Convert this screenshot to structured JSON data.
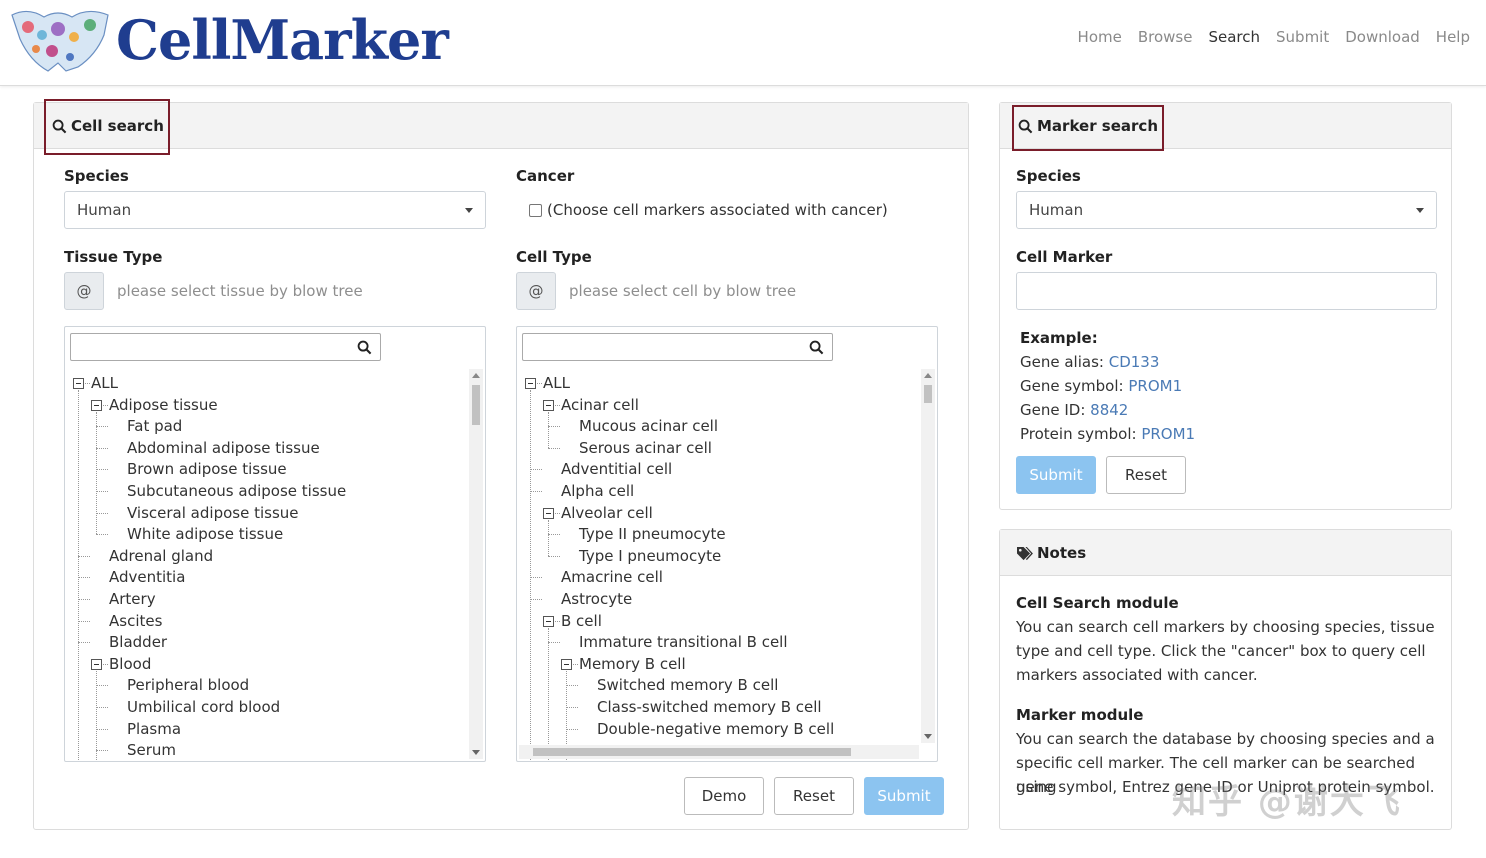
{
  "brand": {
    "name": "CellMarker"
  },
  "nav": {
    "items": [
      "Home",
      "Browse",
      "Search",
      "Submit",
      "Download",
      "Help"
    ],
    "active": "Search"
  },
  "cell_search": {
    "title": "Cell search",
    "species_label": "Species",
    "species_value": "Human",
    "cancer_label": "Cancer",
    "cancer_checkbox_label": "(Choose cell markers associated with cancer)",
    "tissue_label": "Tissue Type",
    "tissue_addon": "@",
    "tissue_placeholder": "please select tissue by blow tree",
    "cell_label": "Cell Type",
    "cell_addon": "@",
    "cell_placeholder": "please select cell by blow tree",
    "tissue_tree": [
      {
        "label": "ALL",
        "level": 0,
        "expanded": true
      },
      {
        "label": "Adipose tissue",
        "level": 1,
        "expanded": true
      },
      {
        "label": "Fat pad",
        "level": 2
      },
      {
        "label": "Abdominal adipose tissue",
        "level": 2
      },
      {
        "label": "Brown adipose tissue",
        "level": 2
      },
      {
        "label": "Subcutaneous adipose tissue",
        "level": 2
      },
      {
        "label": "Visceral adipose tissue",
        "level": 2
      },
      {
        "label": "White adipose tissue",
        "level": 2
      },
      {
        "label": "Adrenal gland",
        "level": 1
      },
      {
        "label": "Adventitia",
        "level": 1
      },
      {
        "label": "Artery",
        "level": 1
      },
      {
        "label": "Ascites",
        "level": 1
      },
      {
        "label": "Bladder",
        "level": 1
      },
      {
        "label": "Blood",
        "level": 1,
        "expanded": true
      },
      {
        "label": "Peripheral blood",
        "level": 2
      },
      {
        "label": "Umbilical cord blood",
        "level": 2
      },
      {
        "label": "Plasma",
        "level": 2
      },
      {
        "label": "Serum",
        "level": 2
      }
    ],
    "cell_tree": [
      {
        "label": "ALL",
        "level": 0,
        "expanded": true
      },
      {
        "label": "Acinar cell",
        "level": 1,
        "expanded": true
      },
      {
        "label": "Mucous acinar cell",
        "level": 2
      },
      {
        "label": "Serous acinar cell",
        "level": 2
      },
      {
        "label": "Adventitial cell",
        "level": 1
      },
      {
        "label": "Alpha cell",
        "level": 1
      },
      {
        "label": "Alveolar cell",
        "level": 1,
        "expanded": true
      },
      {
        "label": "Type II pneumocyte",
        "level": 2
      },
      {
        "label": "Type I pneumocyte",
        "level": 2
      },
      {
        "label": "Amacrine cell",
        "level": 1
      },
      {
        "label": "Astrocyte",
        "level": 1
      },
      {
        "label": "B cell",
        "level": 1,
        "expanded": true
      },
      {
        "label": "Immature transitional B cell",
        "level": 2
      },
      {
        "label": "Memory B cell",
        "level": 2,
        "expanded": true
      },
      {
        "label": "Switched memory B cell",
        "level": 3
      },
      {
        "label": "Class-switched memory B cell",
        "level": 3
      },
      {
        "label": "Double-negative memory B cell",
        "level": 3
      }
    ],
    "demo_label": "Demo",
    "reset_label": "Reset",
    "submit_label": "Submit"
  },
  "marker_search": {
    "title": "Marker search",
    "species_label": "Species",
    "species_value": "Human",
    "cell_marker_label": "Cell Marker",
    "cell_marker_value": "",
    "example_label": "Example:",
    "examples": [
      {
        "label": "Gene alias: ",
        "value": "CD133"
      },
      {
        "label": "Gene symbol: ",
        "value": "PROM1"
      },
      {
        "label": "Gene ID: ",
        "value": "8842"
      },
      {
        "label": "Protein symbol: ",
        "value": "PROM1"
      }
    ],
    "submit_label": "Submit",
    "reset_label": "Reset"
  },
  "notes": {
    "title": "Notes",
    "cell_module_title": "Cell Search module",
    "cell_module_lines": [
      "You can search cell markers by choosing species, tissue",
      "type and cell type. Click the \"cancer\" box to query cell",
      "markers associated with cancer."
    ],
    "marker_module_title": "Marker module",
    "marker_module_lines": [
      "You can search the database by choosing species and a",
      "specific cell marker. The cell marker can be searched using",
      "gene symbol, Entrez gene ID or Uniprot protein symbol."
    ]
  },
  "watermark": "知乎 @谢大飞"
}
